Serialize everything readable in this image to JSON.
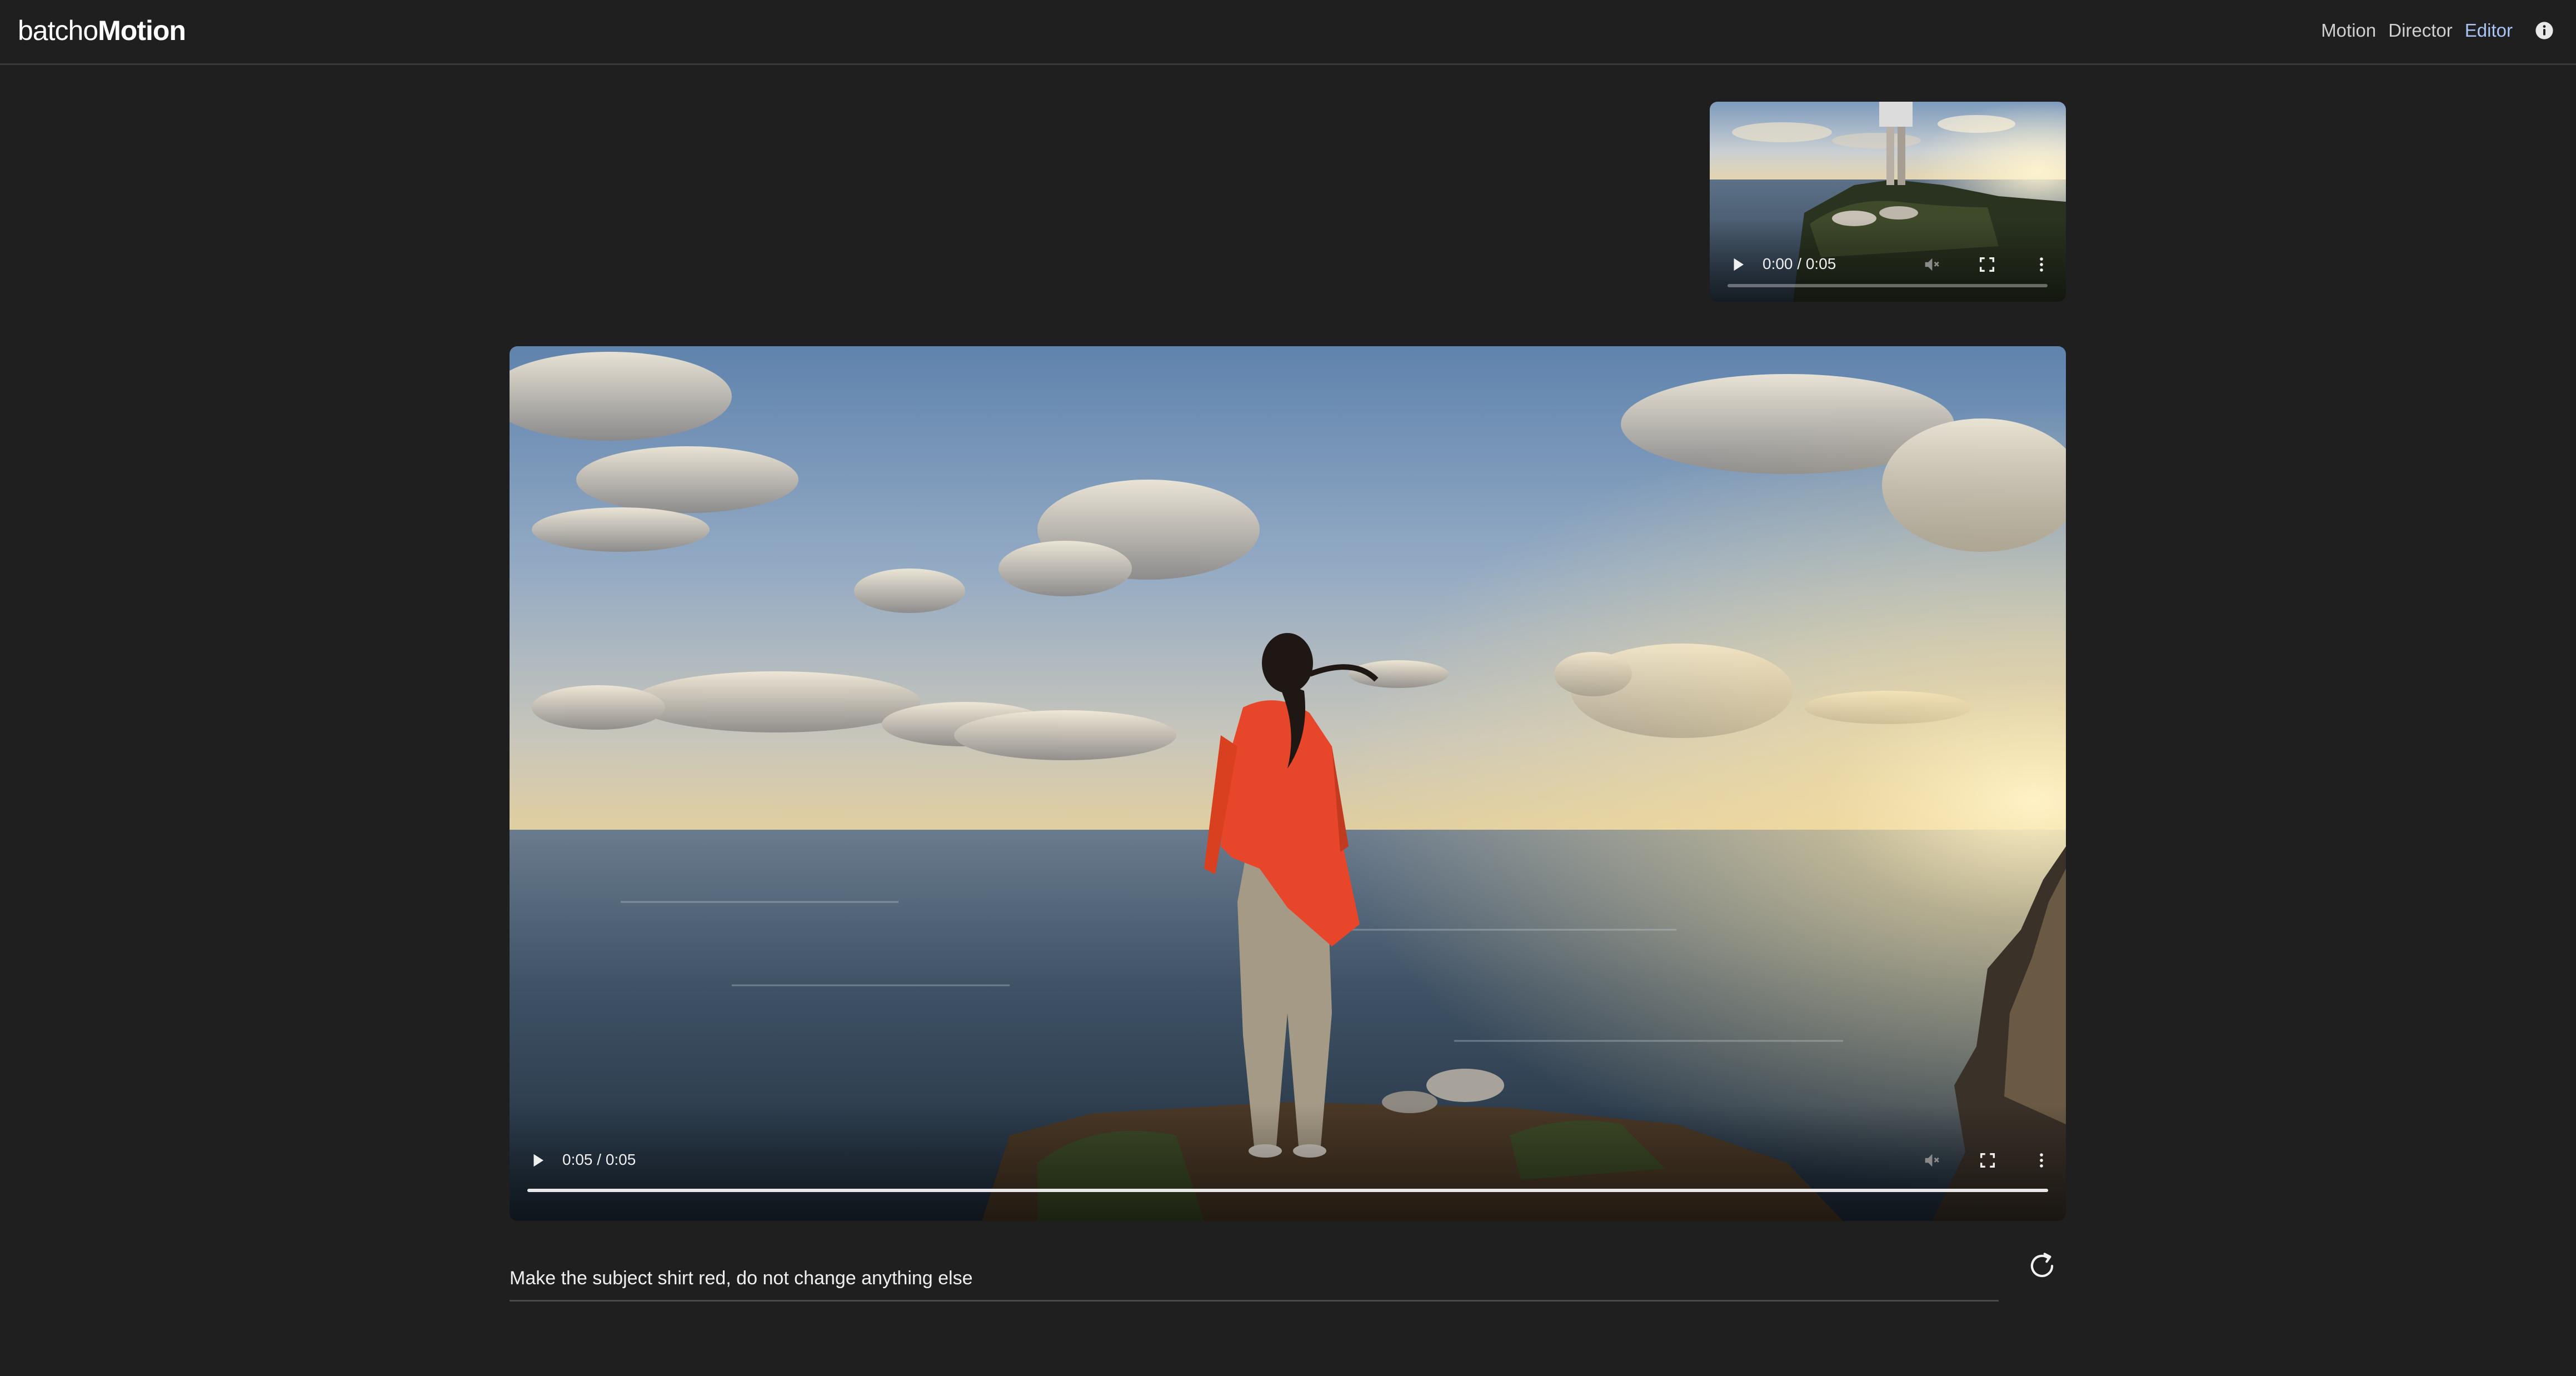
{
  "header": {
    "logo_light": "batcho",
    "logo_bold": "Motion",
    "nav": [
      {
        "label": "Motion",
        "active": false
      },
      {
        "label": "Director",
        "active": false
      },
      {
        "label": "Editor",
        "active": true
      }
    ],
    "info_icon": "info-icon"
  },
  "thumb_video": {
    "time": "0:00 / 0:05",
    "progress": 0.0,
    "icons": [
      "play-icon",
      "volume-muted-icon",
      "fullscreen-icon",
      "more-vertical-icon"
    ]
  },
  "main_video": {
    "time": "0:05 / 0:05",
    "progress": 1.0,
    "icons": [
      "play-icon",
      "volume-muted-icon",
      "fullscreen-icon",
      "more-vertical-icon"
    ]
  },
  "prompt": {
    "value": "Make the subject shirt red, do not change anything else",
    "regenerate_icon": "refresh-icon"
  },
  "colors": {
    "background": "#1f1f1f",
    "active_nav": "#a9c4f5",
    "shirt": "#e8462b"
  }
}
